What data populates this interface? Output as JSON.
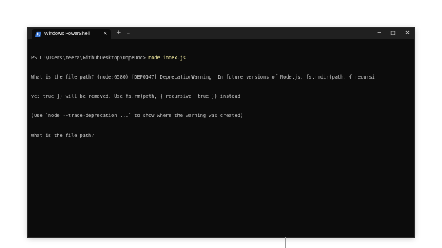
{
  "window": {
    "tab_title": "Windows PowerShell",
    "tab_close": "×",
    "new_tab": "+",
    "dropdown": "⌄",
    "minimize": "−",
    "maximize": "□",
    "close": "✕"
  },
  "console": {
    "prompt": "PS C:\\Users\\meera\\GithubDesktop\\DopeDoc>",
    "command": "node index.js",
    "lines": [
      "What is the file path? (node:6580) [DEP0147] DeprecationWarning: In future versions of Node.js, fs.rmdir(path, { recursi",
      "ve: true }) will be removed. Use fs.rm(path, { recursive: true }) instead",
      "(Use `node --trace-deprecation ...` to show where the warning was created)",
      "What is the file path?"
    ]
  },
  "colors": {
    "terminal_background": "#0c0c0c",
    "terminal_text": "#cccccc",
    "command_text": "#f9f1a5",
    "titlebar": "#202020",
    "powershell_icon": "#3b79d8"
  },
  "icons": {
    "tab": "powershell-icon",
    "close": "close-icon",
    "new_tab": "plus-icon",
    "dropdown": "chevron-down-icon",
    "minimize": "minimize-icon",
    "maximize": "maximize-icon",
    "window_close": "close-icon"
  }
}
